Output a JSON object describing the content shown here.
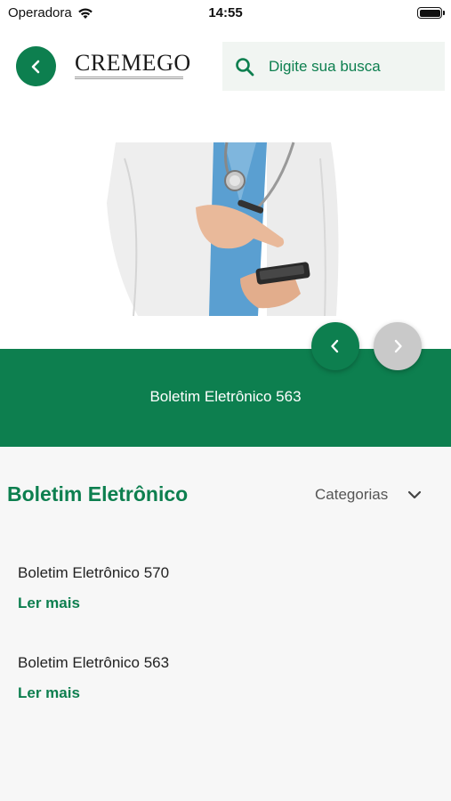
{
  "status": {
    "carrier": "Operadora",
    "time": "14:55"
  },
  "header": {
    "logo_text": "CREMEGO",
    "search_placeholder": "Digite sua busca"
  },
  "banner": {
    "title": "Boletim Eletrônico 563"
  },
  "section": {
    "title": "Boletim Eletrônico",
    "categories_label": "Categorias"
  },
  "articles": [
    {
      "title": "Boletim Eletrônico 570",
      "link": "Ler mais"
    },
    {
      "title": "Boletim Eletrônico 563",
      "link": "Ler mais"
    }
  ],
  "colors": {
    "accent": "#0d7f4f",
    "background": "#f7f7f7",
    "search_bg": "#f1f5f2"
  },
  "icons": [
    "wifi-icon",
    "battery-icon",
    "chevron-left-icon",
    "search-icon",
    "chevron-right-icon",
    "chevron-down-icon"
  ]
}
